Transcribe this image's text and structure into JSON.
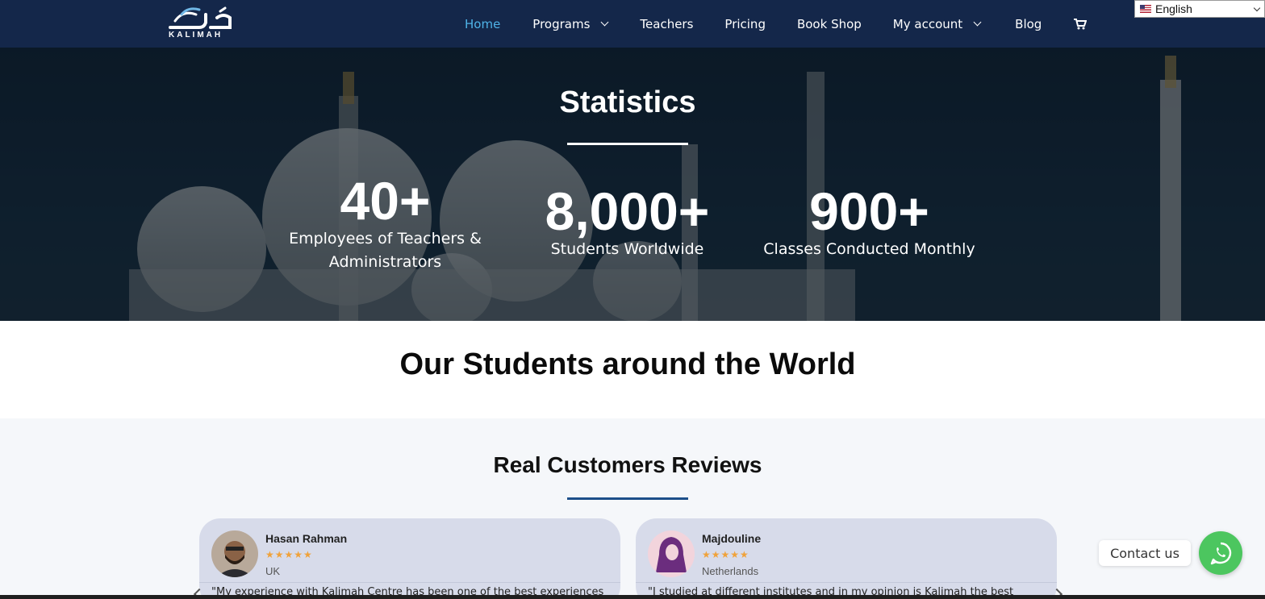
{
  "header": {
    "logo_text": "KALIMAH",
    "nav": [
      {
        "label": "Home",
        "active": true,
        "has_dropdown": false
      },
      {
        "label": "Programs",
        "active": false,
        "has_dropdown": true
      },
      {
        "label": "Teachers",
        "active": false,
        "has_dropdown": false
      },
      {
        "label": "Pricing",
        "active": false,
        "has_dropdown": false
      },
      {
        "label": "Book Shop",
        "active": false,
        "has_dropdown": false
      },
      {
        "label": "My account",
        "active": false,
        "has_dropdown": true
      },
      {
        "label": "Blog",
        "active": false,
        "has_dropdown": false
      }
    ],
    "cart_icon": "cart-icon",
    "language": {
      "selected": "English",
      "flag": "us-flag-icon"
    }
  },
  "stats": {
    "title": "Statistics",
    "items": [
      {
        "number": "40+",
        "label_line1": "Employees of Teachers &",
        "label_line2": "Administrators"
      },
      {
        "number": "8,000+",
        "label_line1": "Students Worldwide",
        "label_line2": ""
      },
      {
        "number": "900+",
        "label_line1": "Classes Conducted Monthly",
        "label_line2": ""
      }
    ]
  },
  "world": {
    "title": "Our Students around the World"
  },
  "reviews": {
    "title": "Real Customers Reviews",
    "items": [
      {
        "name": "Hasan Rahman",
        "stars": "★★★★★",
        "rating": 4.5,
        "country": "UK",
        "text": "\"My experience with Kalimah Centre has been one of the best experiences"
      },
      {
        "name": "Majdouline",
        "stars": "★★★★★",
        "rating": 5,
        "country": "Netherlands",
        "text": "\"I studied at different institutes and in my opinion is Kalimah the best"
      }
    ]
  },
  "contact": {
    "label": "Contact us",
    "icon": "whatsapp-icon"
  },
  "colors": {
    "header_bg": "#14274a",
    "nav_active": "#4fb3e8",
    "stars": "#f0a23a",
    "review_card": "#d7dbea",
    "underline_blue": "#1d4f8a",
    "whatsapp": "#4cc65f"
  }
}
